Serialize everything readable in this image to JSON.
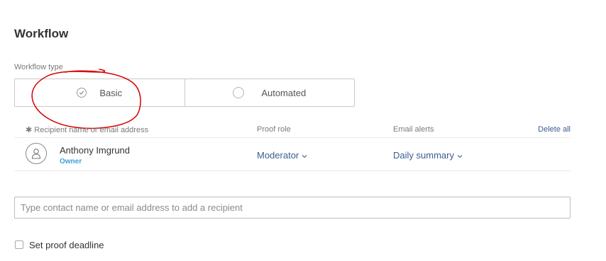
{
  "section": {
    "title": "Workflow"
  },
  "workflow_type": {
    "label": "Workflow type",
    "options": [
      {
        "label": "Basic",
        "selected": true
      },
      {
        "label": "Automated",
        "selected": false
      }
    ]
  },
  "recipients_table": {
    "headers": {
      "recipient": "✱ Recipient name or email address",
      "proof_role": "Proof role",
      "email_alerts": "Email alerts"
    },
    "delete_all_label": "Delete all",
    "rows": [
      {
        "name": "Anthony Imgrund",
        "badge": "Owner",
        "proof_role": "Moderator",
        "email_alerts": "Daily summary"
      }
    ]
  },
  "add_recipient": {
    "placeholder": "Type contact name or email address to add a recipient"
  },
  "deadline": {
    "label": "Set proof deadline",
    "checked": false
  },
  "colors": {
    "link": "#3b5d8f",
    "owner_badge": "#3ba2d6",
    "annotation": "#d40000"
  }
}
